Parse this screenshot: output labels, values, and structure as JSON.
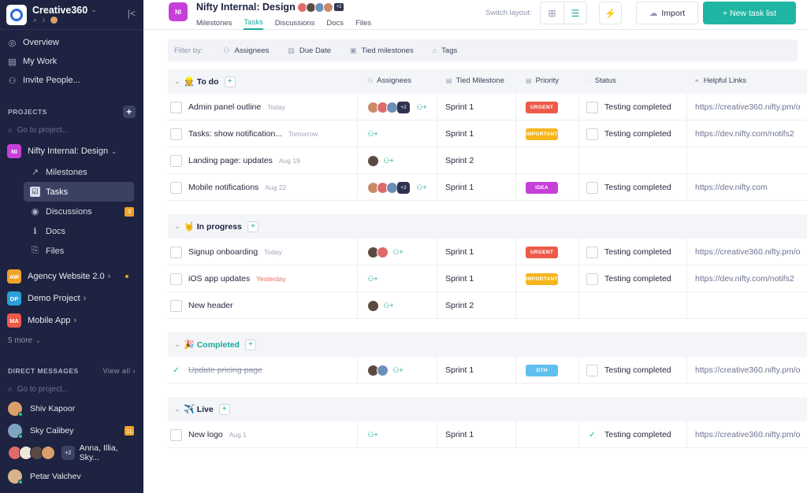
{
  "workspace": {
    "name": "Creative360",
    "badge": "NI"
  },
  "sidebar": {
    "nav": [
      {
        "label": "Overview",
        "icon": "overview-icon",
        "glyph": "◎"
      },
      {
        "label": "My Work",
        "icon": "calendar-icon",
        "glyph": "▤"
      },
      {
        "label": "Invite People...",
        "icon": "invite-icon",
        "glyph": "⚇"
      }
    ],
    "projects_title": "PROJECTS",
    "search_placeholder": "Go to project...",
    "current_project": {
      "badge": "NI",
      "name": "Nifty Internal: Design",
      "color": "#c73fd9"
    },
    "sub_items": [
      {
        "label": "Milestones",
        "icon": "milestones-icon",
        "glyph": "↗"
      },
      {
        "label": "Tasks",
        "icon": "tasks-icon",
        "glyph": "☑"
      },
      {
        "label": "Discussions",
        "icon": "discussions-icon",
        "glyph": "◉",
        "count": "3"
      },
      {
        "label": "Docs",
        "icon": "docs-icon",
        "glyph": "ℹ"
      },
      {
        "label": "Files",
        "icon": "files-icon",
        "glyph": "⎘"
      }
    ],
    "projects": [
      {
        "badge": "AW",
        "name": "Agency Website 2.0",
        "color": "#f0a32b",
        "dot": true
      },
      {
        "badge": "DP",
        "name": "Demo Project",
        "color": "#2b9fd9"
      },
      {
        "badge": "MA",
        "name": "Mobile App",
        "color": "#ee5a4a"
      }
    ],
    "more": "5 more",
    "dm_title": "DIRECT MESSAGES",
    "dm_view_all": "View all",
    "dm_search_placeholder": "Go to project...",
    "dms": [
      {
        "name": "Shiv Kapoor",
        "color": "#d9a06b",
        "online": true
      },
      {
        "name": "Sky Calibey",
        "color": "#7fa3c2",
        "online": true,
        "count": "11"
      }
    ],
    "group_dm": {
      "name": "Anna, Illia, Sky...",
      "more": "+2"
    },
    "last_dm": {
      "name": "Petar Valchev",
      "color": "#d9b38c",
      "online": true
    }
  },
  "header": {
    "project_title": "Nifty Internal: Design",
    "avatar_more": "+2",
    "tabs": [
      "Milestones",
      "Tasks",
      "Discussions",
      "Docs",
      "Files"
    ],
    "active_tab": "Tasks",
    "switch_layout_label": "Switch layout:",
    "import_label": "Import",
    "new_task_list_label": "+ New task list"
  },
  "filter": {
    "label": "Filter by:",
    "items": [
      {
        "label": "Assignees",
        "icon": "assignees-icon",
        "glyph": "⚇"
      },
      {
        "label": "Due Date",
        "icon": "calendar-icon",
        "glyph": "▤"
      },
      {
        "label": "Tied milestones",
        "icon": "milestone-icon",
        "glyph": "▣"
      },
      {
        "label": "Tags",
        "icon": "tag-icon",
        "glyph": "⌂"
      }
    ]
  },
  "columns": {
    "assignees": "Assignees",
    "milestone": "Tied Milestone",
    "priority": "Priority",
    "status": "Status",
    "links": "Helpful Links"
  },
  "pill_colors": {
    "URGENT": "#ee5a4a",
    "IMPORTANT": "#f5b51c",
    "IDEA": "#c73fd9",
    "GTH": "#5ec0ee"
  },
  "groups": [
    {
      "name": "To do",
      "emoji": "👷",
      "show_columns": true,
      "rows": [
        {
          "name": "Admin panel outline",
          "due": "Today",
          "avatars": [
            "#c98a6a",
            "#e06a6a",
            "#6b8fb8"
          ],
          "more": "+2",
          "milestone": "Sprint 1",
          "priority": "URGENT",
          "status": "Testing completed",
          "status_checked": false,
          "link": "https://creative360.nifty.pm/o"
        },
        {
          "name": "Tasks: show notification...",
          "due": "Tomorrow",
          "avatars": [],
          "milestone": "Sprint 1",
          "priority": "IMPORTANT",
          "status": "Testing completed",
          "status_checked": false,
          "link": "https://dev.nifty.com/notifs2"
        },
        {
          "name": "Landing page: updates",
          "due": "Aug 19",
          "avatars": [
            "#5a4a42"
          ],
          "milestone": "Sprint 2",
          "priority": "",
          "status": "",
          "link": ""
        },
        {
          "name": "Mobile notifications",
          "due": "Aug 22",
          "avatars": [
            "#c98a6a",
            "#e06a6a",
            "#6b8fb8"
          ],
          "more": "+2",
          "milestone": "Sprint 1",
          "priority": "IDEA",
          "status": "Testing completed",
          "status_checked": false,
          "link": "https://dev.nifty.com"
        }
      ]
    },
    {
      "name": "In progress",
      "emoji": "🤘",
      "rows": [
        {
          "name": "Signup onboarding",
          "due": "Today",
          "avatars": [
            "#5a4a42",
            "#e06a6a"
          ],
          "milestone": "Sprint 1",
          "priority": "URGENT",
          "status": "Testing completed",
          "status_checked": false,
          "link": "https://creative360.nifty.pm/o"
        },
        {
          "name": "iOS app updates",
          "due": "Yesterday",
          "due_late": true,
          "avatars": [],
          "milestone": "Sprint 1",
          "priority": "IMPORTANT",
          "status": "Testing completed",
          "status_checked": false,
          "link": "https://dev.nifty.com/notifs2"
        },
        {
          "name": "New header",
          "due": "",
          "avatars": [
            "#5a4a42"
          ],
          "milestone": "Sprint 2",
          "priority": "",
          "status": "",
          "link": ""
        }
      ]
    },
    {
      "name": "Completed",
      "emoji": "🎉",
      "teal": true,
      "rows": [
        {
          "name": "Update pricing page",
          "done": true,
          "due": "",
          "avatars": [
            "#5a4a42",
            "#6b8fb8"
          ],
          "milestone": "Sprint 1",
          "priority": "GTH",
          "status": "Testing completed",
          "status_checked": false,
          "link": "https://creative360.nifty.pm/o"
        }
      ]
    },
    {
      "name": "Live",
      "emoji": "✈️",
      "rows": [
        {
          "name": "New logo",
          "due": "Aug 1",
          "avatars": [],
          "milestone": "Sprint 1",
          "priority": "",
          "status": "Testing completed",
          "status_checked": true,
          "link": "https://creative360.nifty.pm/o"
        }
      ]
    }
  ]
}
